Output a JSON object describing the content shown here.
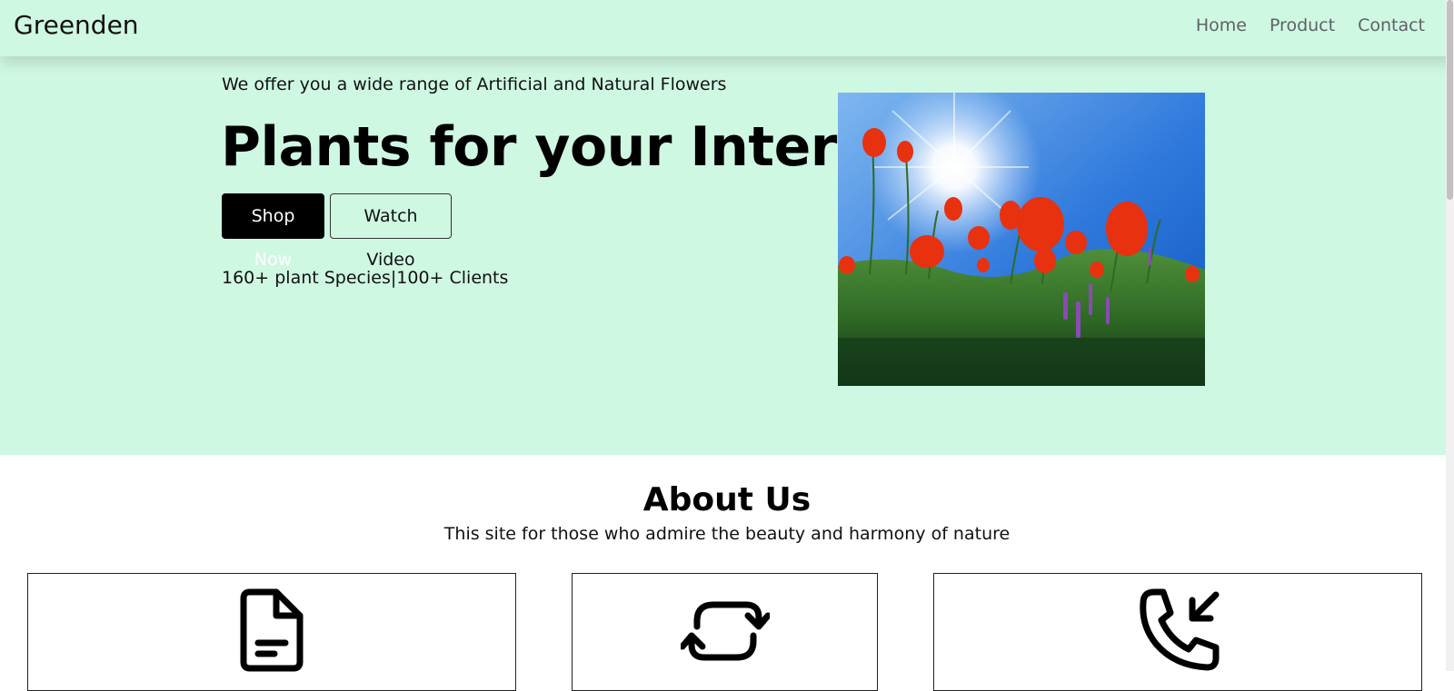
{
  "navbar": {
    "brand": "Greenden",
    "links": [
      "Home",
      "Product",
      "Contact"
    ]
  },
  "hero": {
    "tagline": "We offer you a wide range of Artificial and Natural Flowers",
    "title": "Plants for your Interior",
    "primary_button": "Shop Now",
    "secondary_button": "Watch Video",
    "stats": "160+ plant Species|100+ Clients",
    "image_subject": "poppy-field-photo"
  },
  "about": {
    "title": "About Us",
    "subtitle": "This site for those who admire the beauty and harmony of nature",
    "cards": [
      {
        "icon": "document-icon"
      },
      {
        "icon": "refresh-icon"
      },
      {
        "icon": "phone-incoming-icon"
      }
    ]
  },
  "colors": {
    "hero_background": "#cff8e3",
    "primary_button": "#000000",
    "nav_link": "#5e6266"
  }
}
